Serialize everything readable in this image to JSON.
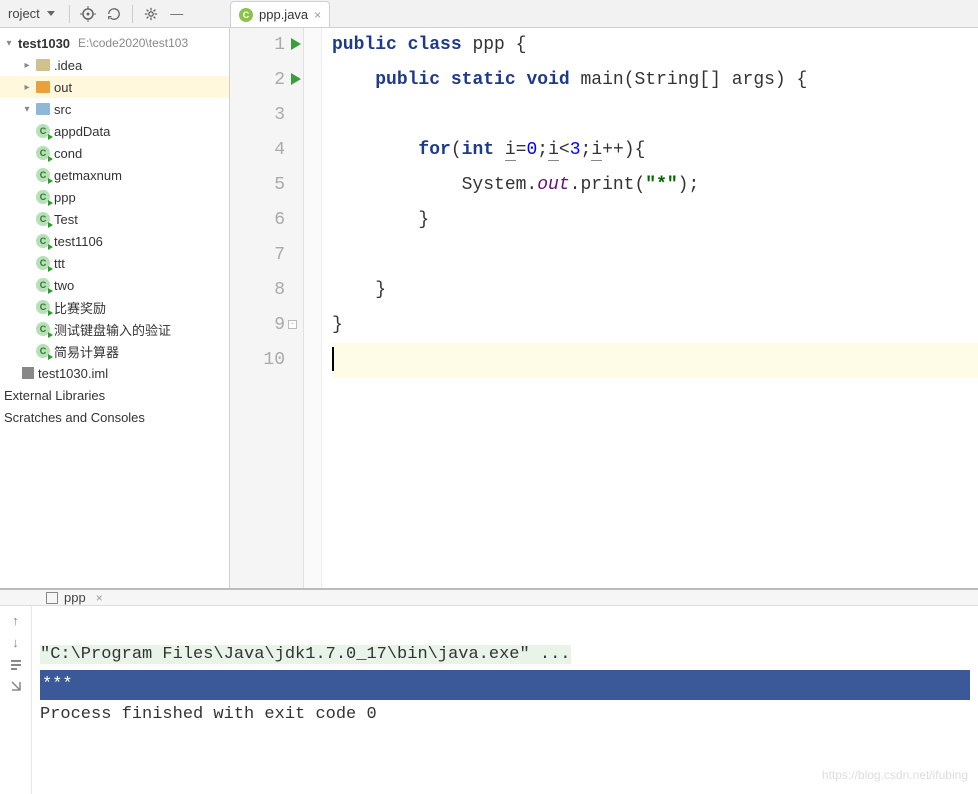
{
  "toolbar": {
    "project_label": "roject"
  },
  "tabs": [
    {
      "name": "ppp.java"
    }
  ],
  "project": {
    "root": {
      "name": "test1030",
      "path": "E:\\code2020\\test103"
    },
    "folders": [
      {
        "name": ".idea",
        "type": "folder"
      },
      {
        "name": "out",
        "type": "folder-orange",
        "selected": true
      },
      {
        "name": "src",
        "type": "folder-blue",
        "expanded": true
      }
    ],
    "src_files": [
      "appdData",
      "cond",
      "getmaxnum",
      "ppp",
      "Test",
      "test1106",
      "ttt",
      "two",
      "比赛奖励",
      "测试键盘输入的验证",
      "简易计算器"
    ],
    "iml": "test1030.iml",
    "external": "External Libraries",
    "scratches": "Scratches and Consoles"
  },
  "code": {
    "lines": [
      {
        "n": 1,
        "run": true,
        "html": "<span class='kw'>public</span> <span class='kw'>class</span> ppp {"
      },
      {
        "n": 2,
        "run": true,
        "html": "    <span class='kw'>public</span> <span class='kw'>static</span> <span class='kw'>void</span> main(String[] args) {"
      },
      {
        "n": 3,
        "html": ""
      },
      {
        "n": 4,
        "html": "        <span class='kw'>for</span>(<span class='kw'>int</span> <span class='underline'>i</span>=<span class='num'>0</span>;<span class='underline'>i</span>&lt;<span class='num'>3</span>;<span class='underline'>i</span>++){"
      },
      {
        "n": 5,
        "html": "            System.<span class='static-it'>out</span>.print(<span class='str'>\"*\"</span>);"
      },
      {
        "n": 6,
        "html": "        }"
      },
      {
        "n": 7,
        "html": ""
      },
      {
        "n": 8,
        "html": "    }"
      },
      {
        "n": 9,
        "fold": true,
        "html": "}"
      },
      {
        "n": 10,
        "current": true,
        "html": "<span class='caret'></span>"
      }
    ]
  },
  "run": {
    "tab_label": "ppp",
    "cmd": "\"C:\\Program Files\\Java\\jdk1.7.0_17\\bin\\java.exe\" ...",
    "output": "***",
    "exit": "Process finished with exit code 0",
    "watermark": "https://blog.csdn.net/ifubing"
  }
}
